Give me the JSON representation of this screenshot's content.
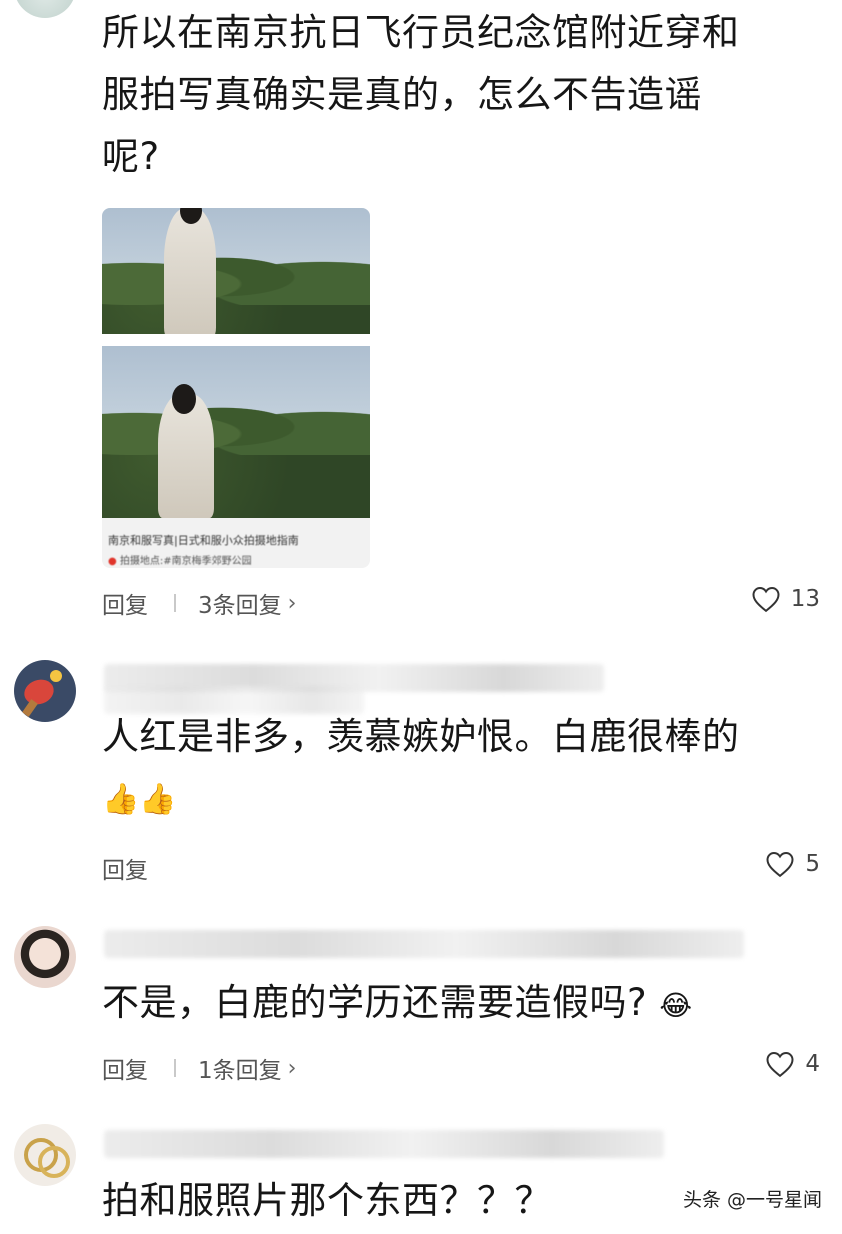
{
  "comments": [
    {
      "text_lines": [
        "所以在南京抗日飞行员纪念馆附近穿和",
        "服拍写真确实是真的，怎么不告造谣",
        "呢?"
      ],
      "reply_label": "回复",
      "more_replies": "3条回复",
      "likes": "13",
      "card": {
        "caption": "南京和服写真|日式和服小众拍摄地指南",
        "location": "拍摄地点:#南京梅季郊野公园"
      }
    },
    {
      "text_lines": [
        "人红是非多，羡慕嫉妒恨。白鹿很棒的"
      ],
      "emoji": "👍👍",
      "reply_label": "回复",
      "likes": "5"
    },
    {
      "text_lines": [
        "不是，白鹿的学历还需要造假吗?"
      ],
      "emoji": "😂",
      "reply_label": "回复",
      "more_replies": "1条回复",
      "likes": "4"
    },
    {
      "text_lines": [
        "拍和服照片那个东西？？？"
      ]
    }
  ],
  "watermark": "头条 @一号星闻",
  "chevron": "›",
  "icons": {
    "like": "heart-outline-icon"
  }
}
